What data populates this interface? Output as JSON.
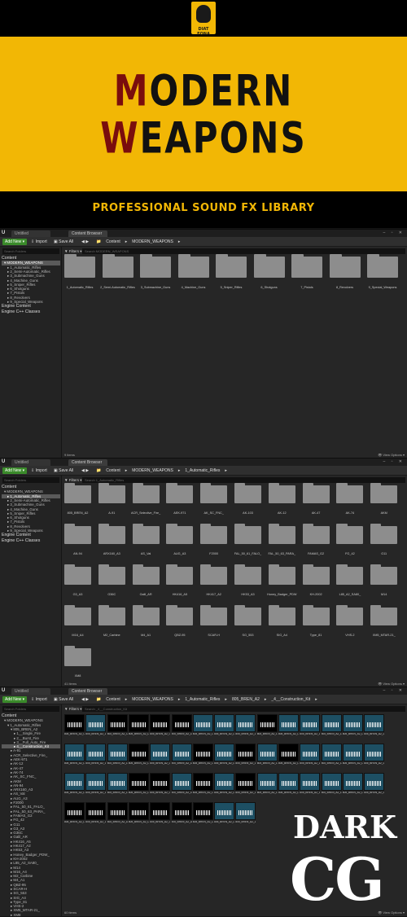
{
  "banner": {
    "logo_text": "DIAT FONA",
    "title_line1_first": "M",
    "title_line1_rest": "ODERN",
    "title_line2_first": "W",
    "title_line2_rest": "EAPONS",
    "subtitle": "PROFESSIONAL SOUND FX LIBRARY"
  },
  "common": {
    "ue_glyph": "U",
    "tab_untitled": "Untitled",
    "tab_browser": "Content Browser",
    "window_controls": "– ▫ ✕",
    "add_new": "Add New ▾",
    "import": "⇩ Import",
    "save_all": "▣ Save All",
    "nav": "◀ ▶",
    "search_folders": "Search Folders",
    "filters": "▼ Filters ▾",
    "view_options": "👁 View Options ▾",
    "folder_icon": "folder-icon"
  },
  "panel1": {
    "breadcrumb": [
      "📁",
      "Content",
      "▸",
      "MODERN_WEAPONS",
      "▸"
    ],
    "search_placeholder": "Search MODERN_WEAPONS",
    "tree": [
      {
        "t": "Content",
        "c": "root"
      },
      {
        "t": "▾ MODERN_WEAPONS",
        "c": "l1 sel"
      },
      {
        "t": "▸ 1_Automatic_Rifles",
        "c": "l2"
      },
      {
        "t": "▸ 2_Semi-Automatic_Rifles",
        "c": "l2"
      },
      {
        "t": "▸ 3_Submachine_Guns",
        "c": "l2"
      },
      {
        "t": "▸ 4_Machine_Guns",
        "c": "l2"
      },
      {
        "t": "▸ 5_Sniper_Rifles",
        "c": "l2"
      },
      {
        "t": "▸ 6_Shotguns",
        "c": "l2"
      },
      {
        "t": "▸ 7_Pistols",
        "c": "l2"
      },
      {
        "t": "▸ 8_Revolvers",
        "c": "l2"
      },
      {
        "t": "▸ 9_Special_Weapons",
        "c": "l2"
      },
      {
        "t": "Engine Content",
        "c": "root"
      },
      {
        "t": "Engine C++ Classes",
        "c": "root"
      }
    ],
    "folders": [
      "1_Automatic_Rifles",
      "2_Semi-Automatic_Rifles",
      "3_Submachine_Guns",
      "4_Machine_Guns",
      "5_Sniper_Rifles",
      "6_Shotguns",
      "7_Pistols",
      "8_Revolvers",
      "9_Special_Weapons"
    ],
    "status": "9 items"
  },
  "panel2": {
    "breadcrumb": [
      "📁",
      "Content",
      "▸",
      "MODERN_WEAPONS",
      "▸",
      "1_Automatic_Rifles",
      "▸"
    ],
    "search_placeholder": "Search 1_Automatic_Rifles",
    "tree": [
      {
        "t": "Content",
        "c": "root"
      },
      {
        "t": "▾ MODERN_WEAPONS",
        "c": "l1"
      },
      {
        "t": "▸ 1_Automatic_Rifles",
        "c": "l2 sel"
      },
      {
        "t": "▸ 2_Semi-Automatic_Rifles",
        "c": "l2"
      },
      {
        "t": "▸ 3_Submachine_Guns",
        "c": "l2"
      },
      {
        "t": "▸ 4_Machine_Guns",
        "c": "l2"
      },
      {
        "t": "▸ 5_Sniper_Rifles",
        "c": "l2"
      },
      {
        "t": "▸ 6_Shotguns",
        "c": "l2"
      },
      {
        "t": "▸ 7_Pistols",
        "c": "l2"
      },
      {
        "t": "▸ 8_Revolvers",
        "c": "l2"
      },
      {
        "t": "▸ 9_Special_Weapons",
        "c": "l2"
      },
      {
        "t": "Engine Content",
        "c": "root"
      },
      {
        "t": "Engine C++ Classes",
        "c": "root"
      }
    ],
    "folders": [
      "805_BREN_A2",
      "A-91",
      "ACR_Selective_Fire_",
      "AEK-971",
      "AK_SC_FNC_",
      "AK-103",
      "AK-12",
      "AK-47",
      "AK-74",
      "AKM",
      "AN-94",
      "ARX160_A3",
      "AS_Val",
      "AUG_A3",
      "F2000",
      "FAL_50_61_FALO_",
      "FAL_50_63_PARA_",
      "FAMAS_G2",
      "FG_42",
      "G11",
      "G3_A3",
      "G36C",
      "Galil_AR",
      "HK416_A5",
      "HK417_A2",
      "HK53_A3",
      "Honey_Badger_PDW",
      "KH-2002",
      "L85_A2_SA80_",
      "M14",
      "M16_A4",
      "M2_Carbine",
      "M4_A1",
      "QBZ-95",
      "SCAR-H",
      "SG_553",
      "SIG_A4",
      "Type_81",
      "VHS-2",
      "XM5_MTAR-21_",
      "XM8"
    ],
    "status": "41 items"
  },
  "panel3": {
    "breadcrumb": [
      "📁",
      "Content",
      "▸",
      "MODERN_WEAPONS",
      "▸",
      "1_Automatic_Rifles",
      "▸",
      "805_BREN_A2",
      "▸",
      "_4__Construction_Kit",
      "▸"
    ],
    "search_placeholder": "Search _4__Construction_Kit",
    "tree": [
      {
        "t": "Content",
        "c": "root"
      },
      {
        "t": "▾ MODERN_WEAPONS",
        "c": "l1"
      },
      {
        "t": "▾ 1_Automatic_Rifles",
        "c": "l2"
      },
      {
        "t": "▾ 805_BREN_A2",
        "c": "l3"
      },
      {
        "t": "▸ 1__Single_Fire",
        "c": "l4"
      },
      {
        "t": "▸ 2__Burst_Fire",
        "c": "l4"
      },
      {
        "t": "▸ 3__Full_Auto_Fire",
        "c": "l4"
      },
      {
        "t": "▸ 4__Construction_Kit",
        "c": "l4 sel"
      },
      {
        "t": "▸ A-91",
        "c": "l3"
      },
      {
        "t": "▸ ACR_Selective_Fire_",
        "c": "l3"
      },
      {
        "t": "▸ AEK-971",
        "c": "l3"
      },
      {
        "t": "▸ AK-12",
        "c": "l3"
      },
      {
        "t": "▸ AK-47",
        "c": "l3"
      },
      {
        "t": "▸ AK-74",
        "c": "l3"
      },
      {
        "t": "▸ AK_SC_FNC_",
        "c": "l3"
      },
      {
        "t": "▸ AKM",
        "c": "l3"
      },
      {
        "t": "▸ AN-94",
        "c": "l3"
      },
      {
        "t": "▸ ARX160_A3",
        "c": "l3"
      },
      {
        "t": "▸ AS_Val",
        "c": "l3"
      },
      {
        "t": "▸ AUG_A3",
        "c": "l3"
      },
      {
        "t": "▸ F2000",
        "c": "l3"
      },
      {
        "t": "▸ FAL_50_61_FALO_",
        "c": "l3"
      },
      {
        "t": "▸ FAL_50_63_PARA_",
        "c": "l3"
      },
      {
        "t": "▸ FAMAS_G2",
        "c": "l3"
      },
      {
        "t": "▸ FG_42",
        "c": "l3"
      },
      {
        "t": "▸ G11",
        "c": "l3"
      },
      {
        "t": "▸ G3_A3",
        "c": "l3"
      },
      {
        "t": "▸ G36C",
        "c": "l3"
      },
      {
        "t": "▸ Galil_AR",
        "c": "l3"
      },
      {
        "t": "▸ HK416_A5",
        "c": "l3"
      },
      {
        "t": "▸ HK417_A2",
        "c": "l3"
      },
      {
        "t": "▸ HK53_A3",
        "c": "l3"
      },
      {
        "t": "▸ Honey_Badger_PDW_",
        "c": "l3"
      },
      {
        "t": "▸ KH-2002",
        "c": "l3"
      },
      {
        "t": "▸ L85_A2_SA80_",
        "c": "l3"
      },
      {
        "t": "▸ M14",
        "c": "l3"
      },
      {
        "t": "▸ M16_A4",
        "c": "l3"
      },
      {
        "t": "▸ M2_Carbine",
        "c": "l3"
      },
      {
        "t": "▸ M4_A1",
        "c": "l3"
      },
      {
        "t": "▸ QBZ-95",
        "c": "l3"
      },
      {
        "t": "▸ SCAR-H",
        "c": "l3"
      },
      {
        "t": "▸ SG_553",
        "c": "l3"
      },
      {
        "t": "▸ SIG_A4",
        "c": "l3"
      },
      {
        "t": "▸ Type_81",
        "c": "l3"
      },
      {
        "t": "▸ VHS-2",
        "c": "l3"
      },
      {
        "t": "▸ XM5_MTAR-21_",
        "c": "l3"
      },
      {
        "t": "▸ XM8",
        "c": "l3"
      }
    ],
    "waves": [
      {
        "l": "805_BREN_A2_Cut",
        "d": true
      },
      {
        "l": "805_BREN_A2_Loop_Cut",
        "d": false
      },
      {
        "l": "805_BREN_A2_Cut",
        "d": true
      },
      {
        "l": "805_BREN_A2_Dist",
        "d": true
      },
      {
        "l": "805_BREN_A2_Cut",
        "d": true
      },
      {
        "l": "805_BREN_A2_Loop_Cut",
        "d": true
      },
      {
        "l": "805_BREN_A2_Loop_700_RPM",
        "d": false
      },
      {
        "l": "805_BREN_A2_Loop_750_RPM",
        "d": false
      },
      {
        "l": "805_BREN_A2_Loop_800_RPM",
        "d": false
      },
      {
        "l": "805_BREN_A2_Loop_850_RPM",
        "d": true
      },
      {
        "l": "805_BREN_A2_Loop_900_RPM",
        "d": false
      },
      {
        "l": "805_BREN_A2_Loop_950_RPM",
        "d": false
      },
      {
        "l": "805_BREN_A2_Loop_1000_RPM",
        "d": false
      },
      {
        "l": "805_BREN_A2_Loop_Cut",
        "d": false
      },
      {
        "l": "805_BREN_A2_Loop_Cut",
        "d": false
      },
      {
        "l": "805_BREN_A2_Loop_700_RPM",
        "d": false
      },
      {
        "l": "805_BREN_A2_Loop_750_RPM",
        "d": false
      },
      {
        "l": "805_BREN_A2_Loop_800_RPM",
        "d": false
      },
      {
        "l": "805_BREN_A2_Loop_850_RPM",
        "d": true
      },
      {
        "l": "805_BREN_A2_Loop_900_RPM",
        "d": false
      },
      {
        "l": "805_BREN_A2_Loop_950_RPM",
        "d": false
      },
      {
        "l": "805_BREN_A2_Loop_1000_RPM",
        "d": true
      },
      {
        "l": "805_BREN_A2_Loop_Cut",
        "d": false
      },
      {
        "l": "805_BREN_A2_Loop_Cut",
        "d": true
      },
      {
        "l": "805_BREN_A2_Loop_Cut",
        "d": false
      },
      {
        "l": "805_BREN_A2_Loop_Cut",
        "d": true
      },
      {
        "l": "805_BREN_A2_Loop_Cut",
        "d": false
      },
      {
        "l": "805_BREN_A2_Loop_Cut",
        "d": false
      },
      {
        "l": "805_BREN_A2_Loop_Cut",
        "d": false
      },
      {
        "l": "805_BREN_A2_Loop_Cut",
        "d": false
      },
      {
        "l": "805_BREN_A2_Loop_700_RPM",
        "d": false
      },
      {
        "l": "805_BREN_A2_Loop_750_RPM",
        "d": false
      },
      {
        "l": "805_BREN_A2_Loop_800_RPM",
        "d": false
      },
      {
        "l": "805_BREN_A2_Loop_850_RPM",
        "d": true
      },
      {
        "l": "805_BREN_A2_Loop_900_RPM",
        "d": true
      },
      {
        "l": "805_BREN_A2_Loop_950_RPM",
        "d": false
      },
      {
        "l": "805_BREN_A2_Loop_1000_RPM",
        "d": true
      },
      {
        "l": "805_BREN_A2_Loop_Cut",
        "d": false
      },
      {
        "l": "805_BREN_A2_Loop_Cut",
        "d": true
      },
      {
        "l": "805_BREN_A2_Loop_Cut",
        "d": false
      },
      {
        "l": "805_BREN_A2_Loop_Cut",
        "d": false
      },
      {
        "l": "805_BREN_A2_Loop_Cut",
        "d": false
      },
      {
        "l": "805_BREN_A2_Loop_Cut",
        "d": false
      },
      {
        "l": "805_BREN_A2_Loop_Cut",
        "d": false
      },
      {
        "l": "805_BREN_A2_Loop_Cut",
        "d": false
      },
      {
        "l": "805_BREN_A2_Loop_700_RPM",
        "d": true
      },
      {
        "l": "805_BREN_A2_Loop_750_RPM",
        "d": true
      },
      {
        "l": "805_BREN_A2_Dist",
        "d": true
      },
      {
        "l": "805_BREN_A2_Distant_Cut",
        "d": true
      },
      {
        "l": "805_BREN_A2_Distant_Cut",
        "d": true
      },
      {
        "l": "805_BREN_A2_Distant_Cut",
        "d": true
      },
      {
        "l": "805_BREN_A2_Distant_Cut",
        "d": true
      },
      {
        "l": "805_BREN_A2_Loop_Cut",
        "d": false
      },
      {
        "l": "805_BREN_A2_Loop_Cut",
        "d": false
      }
    ],
    "status": "60 items"
  },
  "watermark": {
    "line1": "DARK",
    "line2": "CG"
  }
}
